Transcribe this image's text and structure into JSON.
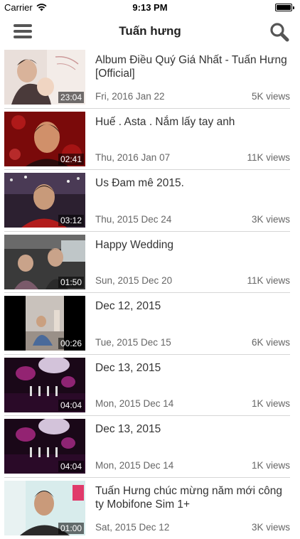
{
  "status": {
    "carrier": "Carrier",
    "time": "9:13 PM"
  },
  "nav": {
    "title": "Tuấn hưng"
  },
  "videos": [
    {
      "title": "Album Điều Quý Giá Nhất - Tuấn Hưng [Official]",
      "duration": "23:04",
      "date": "Fri, 2016 Jan 22",
      "views": "5K views"
    },
    {
      "title": "Huế . Asta . Nắm lấy tay anh",
      "duration": "02:41",
      "date": "Thu, 2016 Jan 07",
      "views": "11K views"
    },
    {
      "title": "Us Đam mê 2015.",
      "duration": "03:12",
      "date": "Thu, 2015 Dec 24",
      "views": "3K views"
    },
    {
      "title": "Happy Wedding",
      "duration": "01:50",
      "date": "Sun, 2015 Dec 20",
      "views": "11K views"
    },
    {
      "title": "Dec 12, 2015",
      "duration": "00:26",
      "date": "Tue, 2015 Dec 15",
      "views": "6K views"
    },
    {
      "title": "Dec 13, 2015",
      "duration": "04:04",
      "date": "Mon, 2015 Dec 14",
      "views": "1K views"
    },
    {
      "title": "Dec 13, 2015",
      "duration": "04:04",
      "date": "Mon, 2015 Dec 14",
      "views": "1K views"
    },
    {
      "title": "Tuấn Hưng chúc mừng năm mới công ty Mobifone Sim 1+",
      "duration": "01:00",
      "date": "Sat, 2015 Dec 12",
      "views": "3K views"
    }
  ],
  "icons": {
    "menu": "hamburger-menu-icon",
    "search": "magnifier-icon",
    "wifi": "wifi-icon",
    "battery": "battery-icon"
  }
}
